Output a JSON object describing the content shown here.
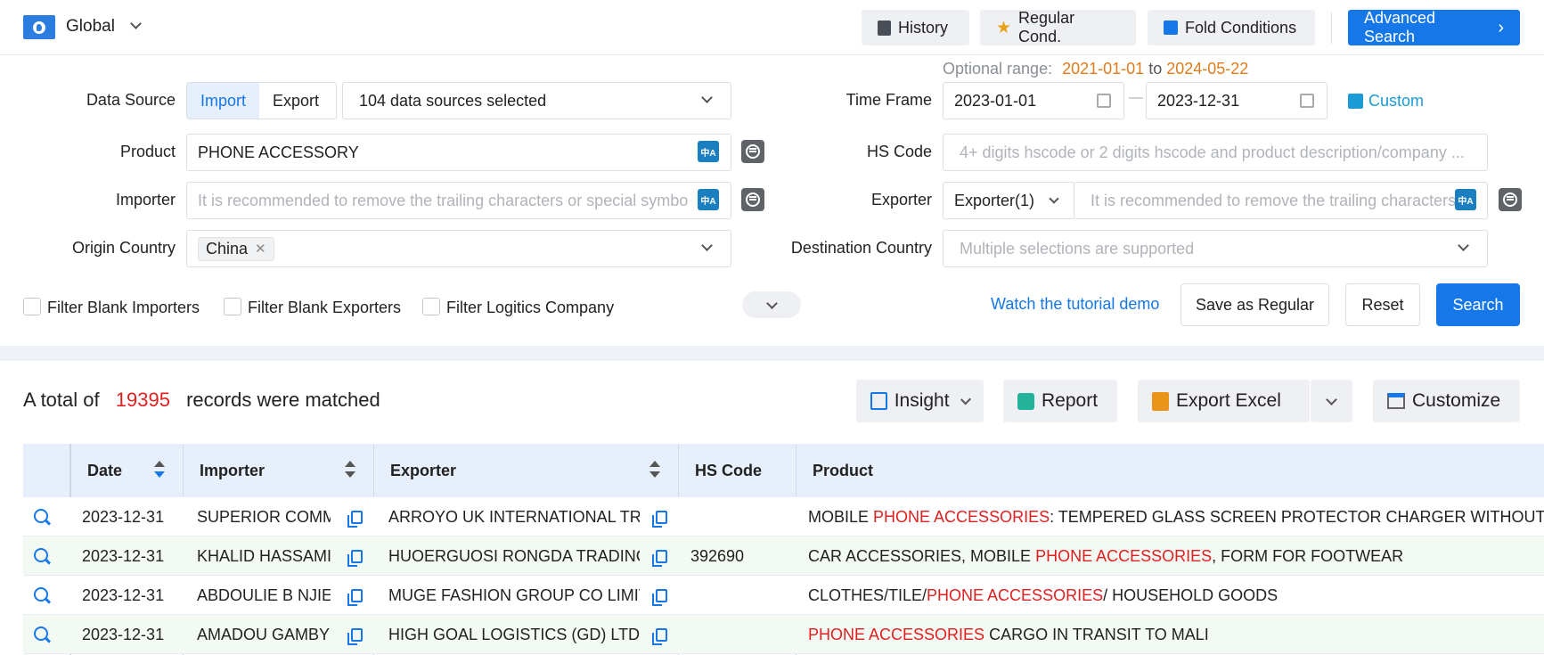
{
  "topbar": {
    "scope": "Global",
    "history": "History",
    "regular": "Regular Cond.",
    "fold": "Fold Conditions",
    "advanced": "Advanced Search"
  },
  "form": {
    "optional_range_label": "Optional range:",
    "optional_from": "2021-01-01",
    "optional_to_word": "to",
    "optional_to": "2024-05-22",
    "data_source_label": "Data Source",
    "import": "Import",
    "export": "Export",
    "sources_selected": "104 data sources selected",
    "time_frame_label": "Time Frame",
    "date_from": "2023-01-01",
    "date_to": "2023-12-31",
    "date_sep": "—",
    "custom": "Custom",
    "product_label": "Product",
    "product_value": "PHONE ACCESSORY",
    "hs_label": "HS Code",
    "hs_placeholder": "4+ digits hscode or 2 digits hscode and product description/company ...",
    "importer_label": "Importer",
    "importer_placeholder": "It is recommended to remove the trailing characters or special symbo",
    "exporter_label": "Exporter",
    "exporter_mode": "Exporter(1)",
    "exporter_placeholder": "It is recommended to remove the trailing characters",
    "origin_label": "Origin Country",
    "origin_chip": "China",
    "dest_label": "Destination Country",
    "dest_placeholder": "Multiple selections are supported",
    "translate_glyph": "中A",
    "filter_importers": "Filter Blank Importers",
    "filter_exporters": "Filter Blank Exporters",
    "filter_logistics": "Filter Logitics Company",
    "tutorial": "Watch the tutorial demo",
    "save_regular": "Save as Regular",
    "reset": "Reset",
    "search": "Search"
  },
  "results": {
    "prefix": "A total of",
    "count": "19395",
    "suffix": "records were matched",
    "insight": "Insight",
    "report": "Report",
    "export_excel": "Export Excel",
    "customize": "Customize"
  },
  "table": {
    "headers": {
      "date": "Date",
      "importer": "Importer",
      "exporter": "Exporter",
      "hs": "HS Code",
      "product": "Product"
    },
    "rows": [
      {
        "date": "2023-12-31",
        "importer": "SUPERIOR COMM",
        "exporter": "ARROYO UK INTERNATIONAL TRA",
        "hs": "",
        "p1": "MOBILE ",
        "p2": "PHONE ACCESSORIES",
        "p3": ": TEMPERED GLASS SCREEN PROTECTOR CHARGER WITHOUT BATT"
      },
      {
        "date": "2023-12-31",
        "importer": "KHALID HASSAMI",
        "exporter": "HUOERGUOSI RONGDA TRADING",
        "hs": "392690",
        "p1": "CAR ACCESSORIES, MOBILE ",
        "p2": "PHONE ACCESSORIES",
        "p3": ", FORM FOR FOOTWEAR"
      },
      {
        "date": "2023-12-31",
        "importer": "ABDOULIE B NJIE",
        "exporter": "MUGE FASHION GROUP CO LIMITE",
        "hs": "",
        "p1": "CLOTHES/TILE/",
        "p2": "PHONE ACCESSORIES",
        "p3": "/ HOUSEHOLD GOODS"
      },
      {
        "date": "2023-12-31",
        "importer": "AMADOU GAMBY",
        "exporter": "HIGH GOAL LOGISTICS (GD) LTD",
        "hs": "",
        "p1": "",
        "p2": "PHONE ACCESSORIES",
        "p3": " CARGO IN TRANSIT TO MALI"
      }
    ]
  },
  "colors": {
    "accent": "#1677e8",
    "highlight": "#e02020",
    "orange": "#e07b1a"
  }
}
